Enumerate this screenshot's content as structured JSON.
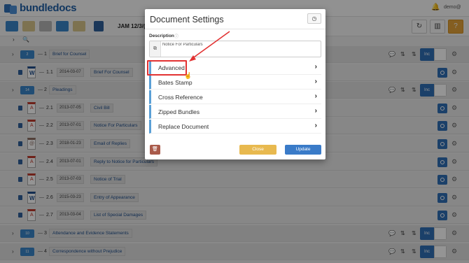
{
  "app": {
    "brand": "bundledocs",
    "user": "demo@",
    "case_ref": "JAM 12/3/(",
    "colors": {
      "accent": "#2f6fb5",
      "help": "#e3a33a",
      "highlight": "#e23232"
    }
  },
  "toolbar": {
    "icons": [
      "add-section-icon",
      "add-document-icon",
      "add-document-stack-icon",
      "add-folder-icon",
      "add-folder-alt-icon",
      "save-icon"
    ],
    "right_icons": [
      "refresh-icon",
      "layout-icon",
      "help-icon"
    ]
  },
  "rows": [
    {
      "kind": "section",
      "badge": "2",
      "dash": "—",
      "num": "1",
      "title": "Brief for Counsel",
      "inc": "Inc"
    },
    {
      "kind": "doc",
      "icon": "word",
      "dash": "—",
      "num": "1.1",
      "date": "2014-03-07",
      "title": "Brief For Counsel",
      "inc": ""
    },
    {
      "kind": "section",
      "badge": "14",
      "dash": "—",
      "num": "2",
      "title": "Pleadings",
      "inc": "Inc"
    },
    {
      "kind": "doc",
      "icon": "pdf",
      "dash": "—",
      "num": "2.1",
      "date": "2013-07-05",
      "title": "Civil Bill",
      "inc": ""
    },
    {
      "kind": "doc",
      "icon": "pdf",
      "dash": "—",
      "num": "2.2",
      "date": "2013-07-01",
      "title": "Notice For Particulars",
      "inc": ""
    },
    {
      "kind": "doc",
      "icon": "eml",
      "dash": "—",
      "num": "2.3",
      "date": "2018-01-23",
      "title": "Email of Replies",
      "inc": ""
    },
    {
      "kind": "doc",
      "icon": "pdf",
      "dash": "—",
      "num": "2.4",
      "date": "2013-07-01",
      "title": "Reply to Notice for Particulars",
      "inc": ""
    },
    {
      "kind": "doc",
      "icon": "pdf",
      "dash": "—",
      "num": "2.5",
      "date": "2013-07-03",
      "title": "Notice of Trial",
      "inc": ""
    },
    {
      "kind": "doc",
      "icon": "word",
      "dash": "—",
      "num": "2.6",
      "date": "2015-03-23",
      "title": "Entry of Appearance",
      "inc": ""
    },
    {
      "kind": "doc",
      "icon": "pdf",
      "dash": "—",
      "num": "2.7",
      "date": "2013-03-04",
      "title": "List of Special Damages",
      "inc": ""
    },
    {
      "kind": "section",
      "badge": "10",
      "dash": "—",
      "num": "3",
      "title": "Attendance and Evidence Statements",
      "inc": "Inc"
    },
    {
      "kind": "section",
      "badge": "11",
      "dash": "—",
      "num": "4",
      "title": "Correspondence without Prejudice",
      "inc": "Inc"
    }
  ],
  "modal": {
    "title": "Document Settings",
    "description_label": "Description",
    "description_value": "Notice For Particulars",
    "sections": [
      "Advanced",
      "Bates Stamp",
      "Cross Reference",
      "Zipped Bundles",
      "Replace Document"
    ],
    "close_label": "Close",
    "update_label": "Update"
  }
}
